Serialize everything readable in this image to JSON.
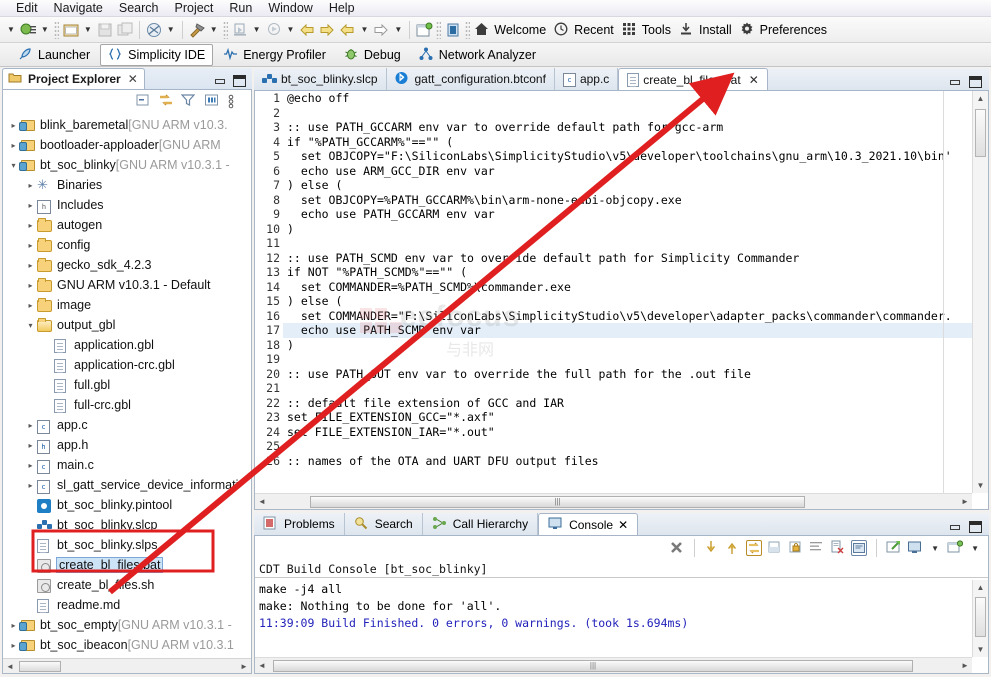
{
  "menubar": {
    "items": [
      "Edit",
      "Navigate",
      "Search",
      "Project",
      "Run",
      "Window",
      "Help"
    ]
  },
  "toolbar": {
    "quick_items": [
      {
        "name": "new-wizard-dropdown",
        "icon": "new-icon"
      },
      {
        "name": "new-folder-dropdown",
        "icon": "folder-icon"
      },
      {
        "name": "save-button",
        "icon": "save-icon"
      },
      {
        "name": "save-all-button",
        "icon": "save-all-icon"
      },
      {
        "name": "build-all-dropdown",
        "icon": "build-icon"
      },
      {
        "name": "hammer-build-dropdown",
        "icon": "hammer-icon"
      },
      {
        "name": "debug-dropdown",
        "icon": "debug-icon"
      },
      {
        "name": "run-dropdown",
        "icon": "run-icon"
      },
      {
        "name": "back-button",
        "icon": "arrow-left-icon"
      },
      {
        "name": "forward-button",
        "icon": "arrow-right-icon"
      },
      {
        "name": "prev-annotation",
        "icon": "arrow-back-yellow-icon"
      },
      {
        "name": "next-annotation",
        "icon": "arrow-next-icon"
      },
      {
        "name": "new-perspective",
        "icon": "new-perspective-icon"
      },
      {
        "name": "simplicity-icon",
        "icon": "simplicity-icon"
      }
    ],
    "text_buttons": [
      {
        "label": "Welcome",
        "icon": "home-icon"
      },
      {
        "label": "Recent",
        "icon": "clock-icon"
      },
      {
        "label": "Tools",
        "icon": "grid-icon"
      },
      {
        "label": "Install",
        "icon": "download-icon"
      },
      {
        "label": "Preferences",
        "icon": "gear-icon"
      }
    ]
  },
  "perspectives": [
    {
      "label": "Launcher",
      "icon": "rocket-icon",
      "active": false
    },
    {
      "label": "Simplicity IDE",
      "icon": "braces-icon",
      "active": true
    },
    {
      "label": "Energy Profiler",
      "icon": "waveform-icon",
      "active": false
    },
    {
      "label": "Debug",
      "icon": "bug-icon",
      "active": false
    },
    {
      "label": "Network Analyzer",
      "icon": "network-icon",
      "active": false
    }
  ],
  "project_explorer": {
    "tab_label": "Project Explorer",
    "close_label": "✕",
    "toolbar_icons": [
      "collapse-all-icon",
      "link-with-editor-icon",
      "filter-icon",
      "view-menu-icon",
      "view-more-icon"
    ],
    "tree": [
      {
        "indent": 0,
        "twisty": "▸",
        "icon": "project-folder-icon",
        "label": "blink_baremetal",
        "suffix": " [GNU ARM v10.3.",
        "selected": false
      },
      {
        "indent": 0,
        "twisty": "▸",
        "icon": "project-folder-icon",
        "label": "bootloader-apploader",
        "suffix": " [GNU ARM",
        "selected": false
      },
      {
        "indent": 0,
        "twisty": "▾",
        "icon": "project-folder-icon",
        "label": "bt_soc_blinky",
        "suffix": " [GNU ARM v10.3.1 -",
        "selected": false
      },
      {
        "indent": 1,
        "twisty": "▸",
        "icon": "binaries-icon",
        "label": "Binaries",
        "suffix": "",
        "selected": false
      },
      {
        "indent": 1,
        "twisty": "▸",
        "icon": "includes-icon",
        "label": "Includes",
        "suffix": "",
        "selected": false
      },
      {
        "indent": 1,
        "twisty": "▸",
        "icon": "folder-icon",
        "label": "autogen",
        "suffix": "",
        "selected": false
      },
      {
        "indent": 1,
        "twisty": "▸",
        "icon": "folder-icon",
        "label": "config",
        "suffix": "",
        "selected": false
      },
      {
        "indent": 1,
        "twisty": "▸",
        "icon": "folder-icon",
        "label": "gecko_sdk_4.2.3",
        "suffix": "",
        "selected": false
      },
      {
        "indent": 1,
        "twisty": "▸",
        "icon": "folder-icon",
        "label": "GNU ARM v10.3.1 - Default",
        "suffix": "",
        "selected": false
      },
      {
        "indent": 1,
        "twisty": "▸",
        "icon": "folder-icon",
        "label": "image",
        "suffix": "",
        "selected": false
      },
      {
        "indent": 1,
        "twisty": "▾",
        "icon": "folder-open-icon",
        "label": "output_gbl",
        "suffix": "",
        "selected": false
      },
      {
        "indent": 2,
        "twisty": "",
        "icon": "file-icon",
        "label": "application.gbl",
        "suffix": "",
        "selected": false
      },
      {
        "indent": 2,
        "twisty": "",
        "icon": "file-icon",
        "label": "application-crc.gbl",
        "suffix": "",
        "selected": false
      },
      {
        "indent": 2,
        "twisty": "",
        "icon": "file-icon",
        "label": "full.gbl",
        "suffix": "",
        "selected": false
      },
      {
        "indent": 2,
        "twisty": "",
        "icon": "file-icon",
        "label": "full-crc.gbl",
        "suffix": "",
        "selected": false
      },
      {
        "indent": 1,
        "twisty": "▸",
        "icon": "c-file-icon",
        "label": "app.c",
        "suffix": "",
        "selected": false
      },
      {
        "indent": 1,
        "twisty": "▸",
        "icon": "h-file-icon",
        "label": "app.h",
        "suffix": "",
        "selected": false
      },
      {
        "indent": 1,
        "twisty": "▸",
        "icon": "c-file-icon",
        "label": "main.c",
        "suffix": "",
        "selected": false
      },
      {
        "indent": 1,
        "twisty": "▸",
        "icon": "c-file-icon",
        "label": "sl_gatt_service_device_informati",
        "suffix": "",
        "selected": false
      },
      {
        "indent": 1,
        "twisty": "",
        "icon": "pintool-icon",
        "label": "bt_soc_blinky.pintool",
        "suffix": "",
        "selected": false
      },
      {
        "indent": 1,
        "twisty": "",
        "icon": "slcp-icon",
        "label": "bt_soc_blinky.slcp",
        "suffix": "",
        "selected": false
      },
      {
        "indent": 1,
        "twisty": "",
        "icon": "file-icon",
        "label": "bt_soc_blinky.slps",
        "suffix": "",
        "selected": false
      },
      {
        "indent": 1,
        "twisty": "",
        "icon": "bat-icon",
        "label": "create_bl_files.bat",
        "suffix": "",
        "selected": true
      },
      {
        "indent": 1,
        "twisty": "",
        "icon": "sh-icon",
        "label": "create_bl_files.sh",
        "suffix": "",
        "selected": false
      },
      {
        "indent": 1,
        "twisty": "",
        "icon": "md-icon",
        "label": "readme.md",
        "suffix": "",
        "selected": false
      },
      {
        "indent": 0,
        "twisty": "▸",
        "icon": "project-folder-icon",
        "label": "bt_soc_empty",
        "suffix": " [GNU ARM v10.3.1 -",
        "selected": false
      },
      {
        "indent": 0,
        "twisty": "▸",
        "icon": "project-folder-icon",
        "label": "bt_soc_ibeacon",
        "suffix": " [GNU ARM v10.3.1",
        "selected": false
      }
    ]
  },
  "editor": {
    "tabs": [
      {
        "label": "bt_soc_blinky.slcp",
        "icon": "slcp-icon",
        "active": false,
        "closable": false
      },
      {
        "label": "gatt_configuration.btconf",
        "icon": "bluetooth-icon",
        "active": false,
        "closable": false
      },
      {
        "label": "app.c",
        "icon": "c-file-icon",
        "active": false,
        "closable": false
      },
      {
        "label": "create_bl_files.bat",
        "icon": "file-icon",
        "active": true,
        "closable": true
      }
    ],
    "close_label": "✕",
    "lines": [
      {
        "n": "1",
        "text": "@echo off",
        "hl": false
      },
      {
        "n": "2",
        "text": "",
        "hl": false
      },
      {
        "n": "3",
        "text": ":: use PATH_GCCARM env var to override default path for gcc-arm",
        "hl": false
      },
      {
        "n": "4",
        "text": "if \"%PATH_GCCARM%\"==\"\" (",
        "hl": false
      },
      {
        "n": "5",
        "text": "  set OBJCOPY=\"F:\\SiliconLabs\\SimplicityStudio\\v5\\developer\\toolchains\\gnu_arm\\10.3_2021.10\\bin'",
        "hl": false
      },
      {
        "n": "6",
        "text": "  echo use ARM_GCC_DIR env var",
        "hl": false
      },
      {
        "n": "7",
        "text": ") else (",
        "hl": false
      },
      {
        "n": "8",
        "text": "  set OBJCOPY=%PATH_GCCARM%\\bin\\arm-none-eabi-objcopy.exe",
        "hl": false
      },
      {
        "n": "9",
        "text": "  echo use PATH_GCCARM env var",
        "hl": false
      },
      {
        "n": "10",
        "text": ")",
        "hl": false
      },
      {
        "n": "11",
        "text": "",
        "hl": false
      },
      {
        "n": "12",
        "text": ":: use PATH_SCMD env var to override default path for Simplicity Commander",
        "hl": false
      },
      {
        "n": "13",
        "text": "if NOT \"%PATH_SCMD%\"==\"\" (",
        "hl": false
      },
      {
        "n": "14",
        "text": "  set COMMANDER=%PATH_SCMD%\\commander.exe",
        "hl": false
      },
      {
        "n": "15",
        "text": ") else (",
        "hl": false
      },
      {
        "n": "16",
        "text": "  set COMMANDER=\"F:\\SiliconLabs\\SimplicityStudio\\v5\\developer\\adapter_packs\\commander\\commander.",
        "hl": false
      },
      {
        "n": "17",
        "text": "  echo use PATH_SCMD env var",
        "hl": true
      },
      {
        "n": "18",
        "text": ")",
        "hl": false
      },
      {
        "n": "19",
        "text": "",
        "hl": false
      },
      {
        "n": "20",
        "text": ":: use PATH_OUT env var to override the full path for the .out file",
        "hl": false
      },
      {
        "n": "21",
        "text": "",
        "hl": false
      },
      {
        "n": "22",
        "text": ":: default file extension of GCC and IAR",
        "hl": false
      },
      {
        "n": "23",
        "text": "set FILE_EXTENSION_GCC=\"*.axf\"",
        "hl": false
      },
      {
        "n": "24",
        "text": "set FILE_EXTENSION_IAR=\"*.out\"",
        "hl": false
      },
      {
        "n": "25",
        "text": "",
        "hl": false
      },
      {
        "n": "26",
        "text": ":: names of the OTA and UART DFU output files",
        "hl": false
      }
    ]
  },
  "console": {
    "tabs": [
      {
        "label": "Problems",
        "icon": "problems-icon",
        "active": false,
        "closable": false
      },
      {
        "label": "Search",
        "icon": "search-icon",
        "active": false,
        "closable": false
      },
      {
        "label": "Call Hierarchy",
        "icon": "call-hierarchy-icon",
        "active": false,
        "closable": false
      },
      {
        "label": "Console",
        "icon": "console-icon",
        "active": true,
        "closable": true
      }
    ],
    "close_label": "✕",
    "toolbar_icons": [
      "terminate-icon",
      "scroll-down-icon",
      "scroll-up-icon",
      "scroll-lock-icon",
      "clear-console-icon",
      "lock-console-icon",
      "word-wrap-icon",
      "clear-icon",
      "pin-console-icon",
      "display-selected-console-icon",
      "open-console-dropdown-icon",
      "new-console-view-icon"
    ],
    "title": "CDT Build Console [bt_soc_blinky]",
    "lines": [
      {
        "text": "make -j4 all",
        "blue": false
      },
      {
        "text": "make: Nothing to be done for 'all'.",
        "blue": false
      },
      {
        "text": "",
        "blue": false
      },
      {
        "text": "11:39:09 Build Finished. 0 errors, 0 warnings. (took 1s.694ms)",
        "blue": true
      }
    ]
  },
  "annotation": {
    "arrow_color": "#e02020",
    "box_color": "#e02020",
    "watermark_text": "eefocus",
    "watermark_sub": "与非网"
  }
}
